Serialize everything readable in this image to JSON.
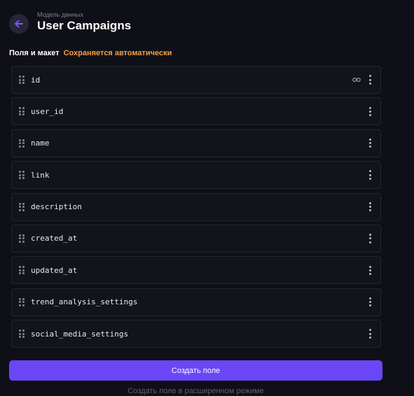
{
  "header": {
    "kicker": "Модель данных",
    "title": "User Campaigns",
    "back_icon": "arrow-left-icon"
  },
  "section": {
    "label": "Поля и макет",
    "autosave_status": "Сохраняется автоматически"
  },
  "fields": [
    {
      "name": "id",
      "primary_key": true
    },
    {
      "name": "user_id",
      "primary_key": false
    },
    {
      "name": "name",
      "primary_key": false
    },
    {
      "name": "link",
      "primary_key": false
    },
    {
      "name": "description",
      "primary_key": false
    },
    {
      "name": "created_at",
      "primary_key": false
    },
    {
      "name": "updated_at",
      "primary_key": false
    },
    {
      "name": "trend_analysis_settings",
      "primary_key": false
    },
    {
      "name": "social_media_settings",
      "primary_key": false
    }
  ],
  "actions": {
    "create_field_label": "Создать поле",
    "advanced_link_label": "Создать поле в расширенном режиме"
  },
  "colors": {
    "background": "#0f1017",
    "accent": "#6b46f6",
    "autosave": "#f5a041",
    "row_border": "#24252f"
  }
}
